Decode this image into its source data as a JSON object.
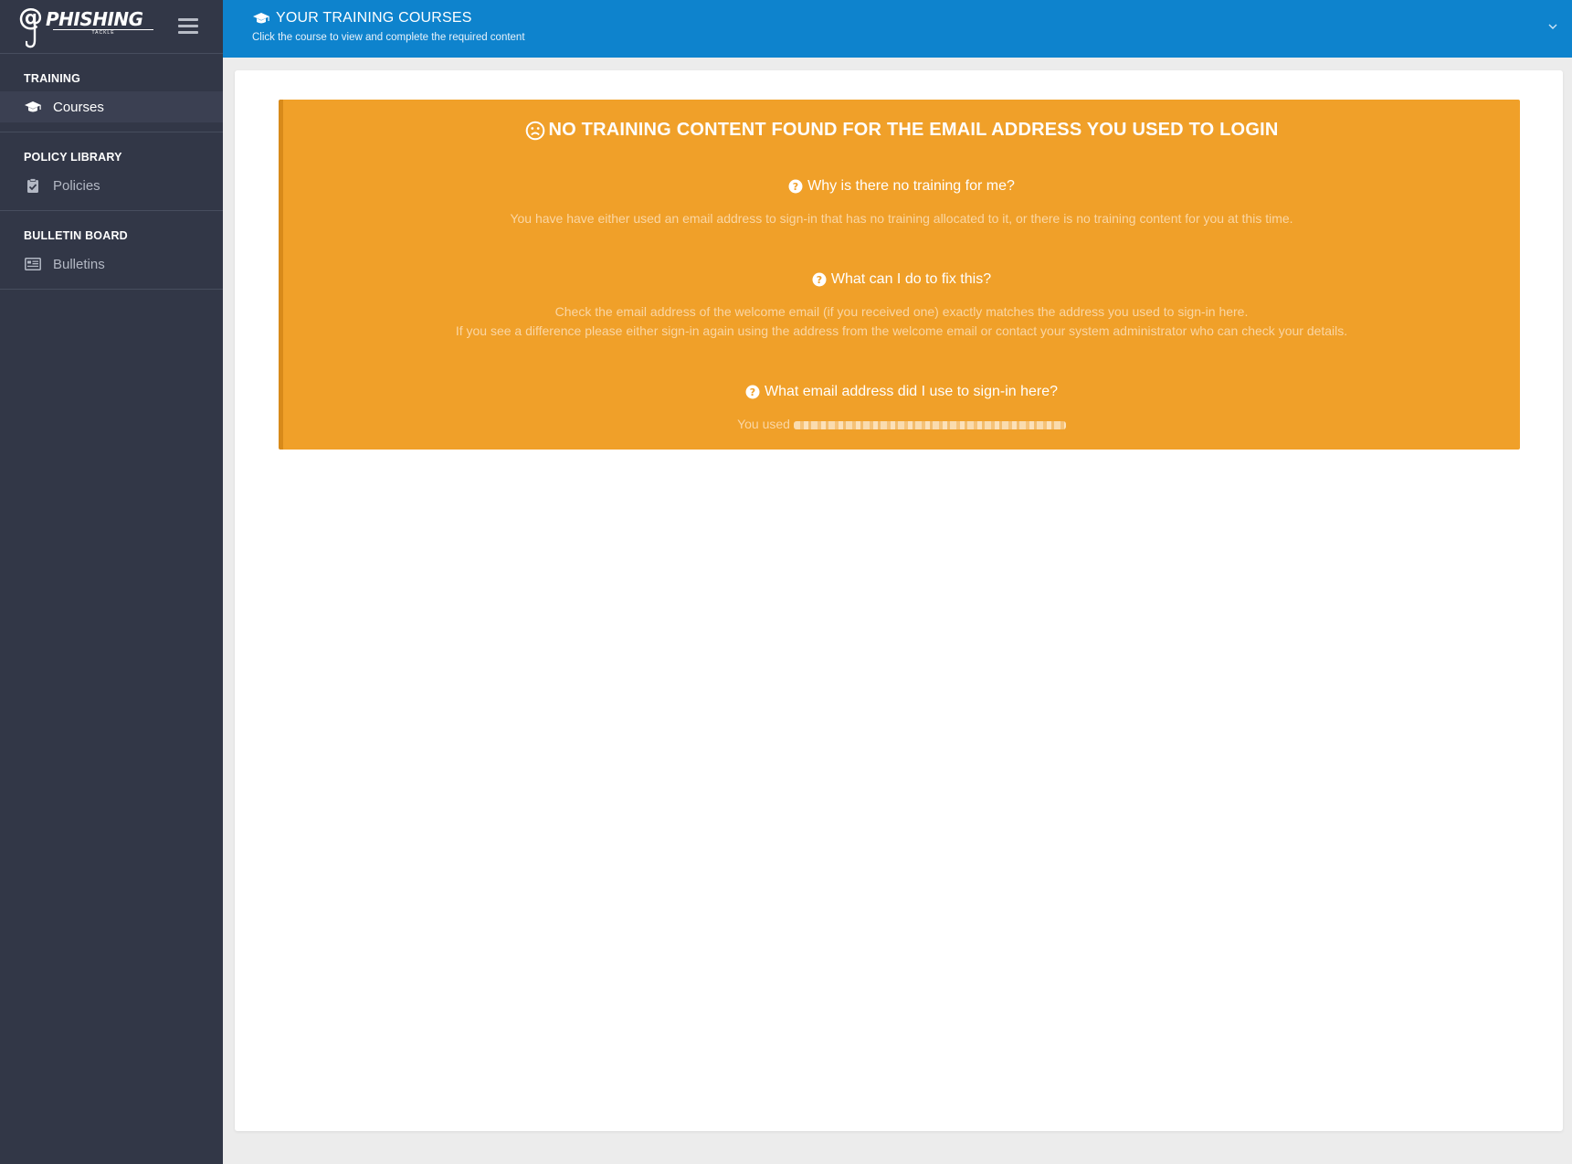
{
  "brand": {
    "name": "PHISHING",
    "sub": "TACKLE"
  },
  "sidebar": {
    "sections": [
      {
        "header": "TRAINING",
        "item": {
          "label": "Courses",
          "icon": "graduation-cap-icon",
          "active": true
        }
      },
      {
        "header": "POLICY LIBRARY",
        "item": {
          "label": "Policies",
          "icon": "clipboard-check-icon",
          "active": false
        }
      },
      {
        "header": "BULLETIN BOARD",
        "item": {
          "label": "Bulletins",
          "icon": "newspaper-icon",
          "active": false
        }
      }
    ]
  },
  "topbar": {
    "title": "YOUR TRAINING COURSES",
    "subtitle": "Click the course to view and complete the required content"
  },
  "alert": {
    "title": "NO TRAINING CONTENT FOUND FOR THE EMAIL ADDRESS YOU USED TO LOGIN",
    "q1": "Why is there no training for me?",
    "a1": "You have have either used an email address to sign-in that has no training allocated to it, or there is no training content for you at this time.",
    "q2": "What can I do to fix this?",
    "a2_line1": "Check the email address of the welcome email (if you received one) exactly matches the address you used to sign-in here.",
    "a2_line2": "If you see a difference please either sign-in again using the address from the welcome email or contact your system administrator who can check your details.",
    "q3": "What email address did I use to sign-in here?",
    "a3_prefix": "You used"
  },
  "colors": {
    "sidebar": "#323747",
    "topbar": "#0e83cd",
    "alert": "#f0a029"
  }
}
